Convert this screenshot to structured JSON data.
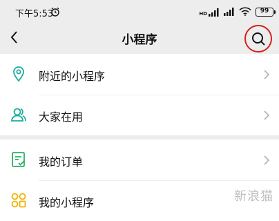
{
  "status": {
    "time": "下午5:53",
    "battery": "99",
    "network": "HD"
  },
  "nav": {
    "title": "小程序"
  },
  "group1": [
    {
      "label": "附近的小程序",
      "icon": "location-pin-icon"
    },
    {
      "label": "大家在用",
      "icon": "users-icon"
    }
  ],
  "group2": [
    {
      "label": "我的订单",
      "icon": "order-list-icon"
    },
    {
      "label": "我的小程序",
      "icon": "grid-apps-icon"
    }
  ],
  "watermark": "新浪猫",
  "colors": {
    "teal": "#1aad9c",
    "green": "#2aae67",
    "orange": "#f0b100",
    "highlight": "#d3221c"
  }
}
